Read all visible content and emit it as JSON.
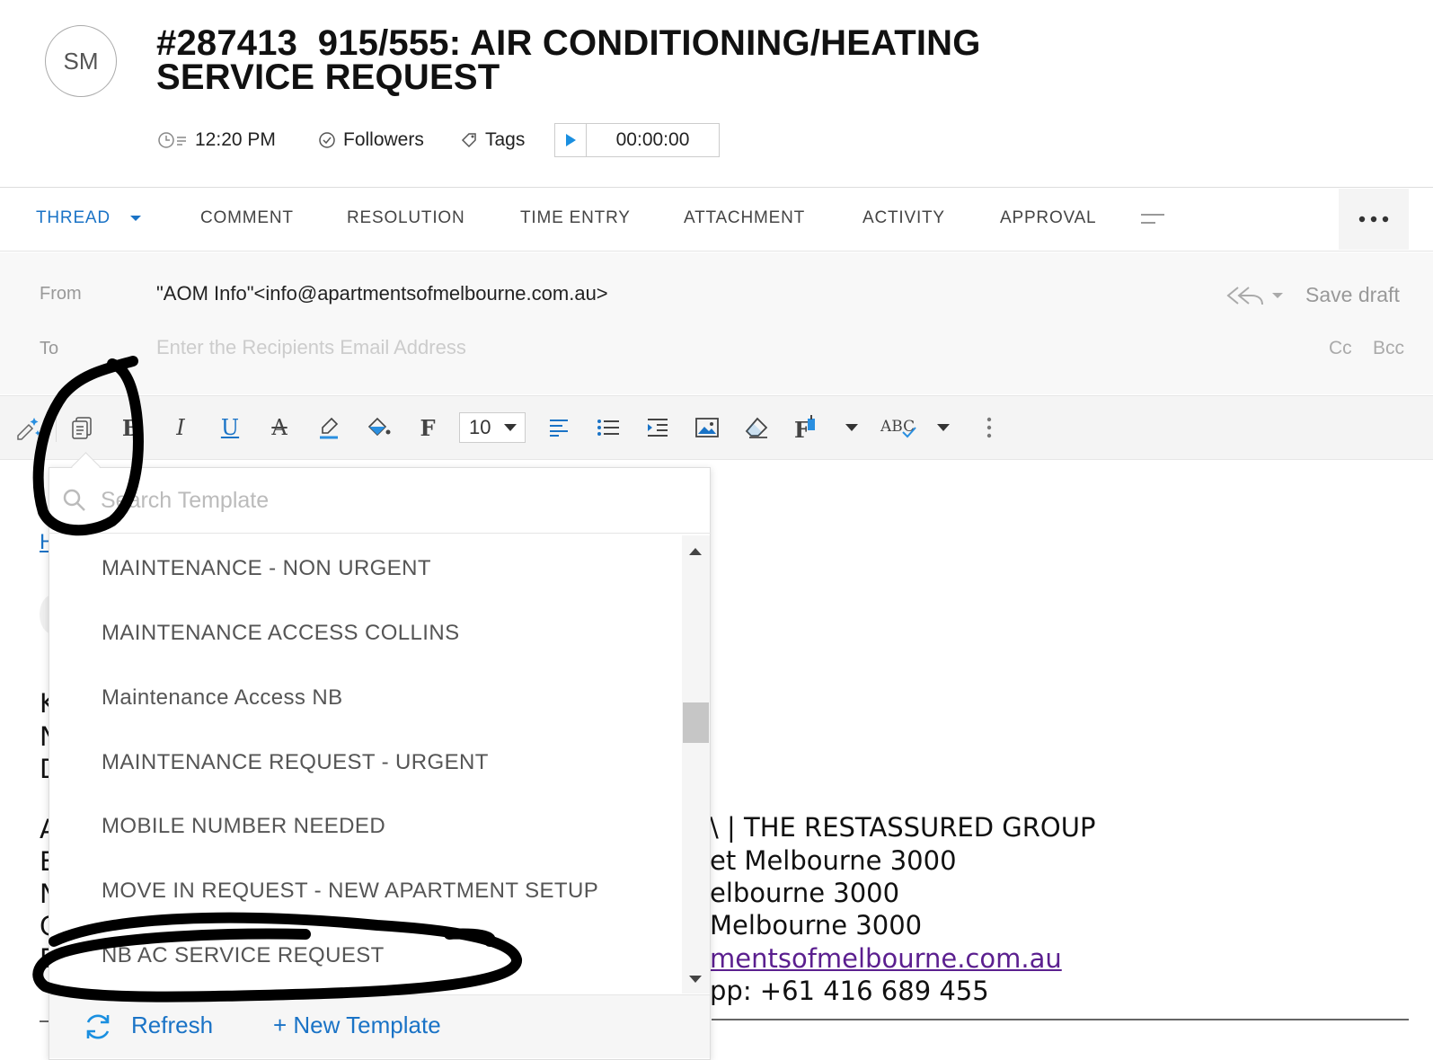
{
  "header": {
    "avatar_initials": "SM",
    "title_line1": "#287413  915/555: AIR CONDITIONING/HEATING",
    "title_line2": "SERVICE REQUEST",
    "time": "12:20 PM",
    "followers_label": "Followers",
    "tags_label": "Tags",
    "timer_value": "00:00:00"
  },
  "tabs": [
    {
      "label": "THREAD"
    },
    {
      "label": "COMMENT"
    },
    {
      "label": "RESOLUTION"
    },
    {
      "label": "TIME ENTRY"
    },
    {
      "label": "ATTACHMENT"
    },
    {
      "label": "ACTIVITY"
    },
    {
      "label": "APPROVAL"
    }
  ],
  "compose": {
    "from_label": "From",
    "from_value": "\"AOM Info\"<info@apartmentsofmelbourne.com.au>",
    "to_label": "To",
    "to_placeholder": "Enter the Recipients Email Address",
    "save_draft": "Save draft",
    "cc": "Cc",
    "bcc": "Bcc"
  },
  "toolbar": {
    "font_size": "10",
    "spellcheck_label": "ABC"
  },
  "template_dropdown": {
    "search_placeholder": "Search Template",
    "items": [
      "MAINTENANCE - NON URGENT",
      "MAINTENANCE ACCESS COLLINS",
      "Maintenance Access NB",
      "MAINTENANCE REQUEST - URGENT",
      "MOBILE NUMBER NEEDED",
      "MOVE IN REQUEST - NEW APARTMENT SETUP",
      "NB AC SERVICE REQUEST"
    ],
    "refresh_label": "Refresh",
    "new_template_label": "+ New Template"
  },
  "body_text": {
    "left_letters": [
      "H",
      "K",
      "N",
      "D",
      "A",
      "E",
      "N",
      "C",
      "E"
    ],
    "line1": "\\ | THE RESTASSURED GROUP",
    "line2": "et Melbourne 3000",
    "line3": "elbourne 3000",
    "line4": "Melbourne 3000",
    "line5": "mentsofmelbourne.com.au",
    "line6": "pp: +61 416 689 455"
  },
  "colors": {
    "accent": "#1a73c6",
    "annotation": "#000000"
  }
}
